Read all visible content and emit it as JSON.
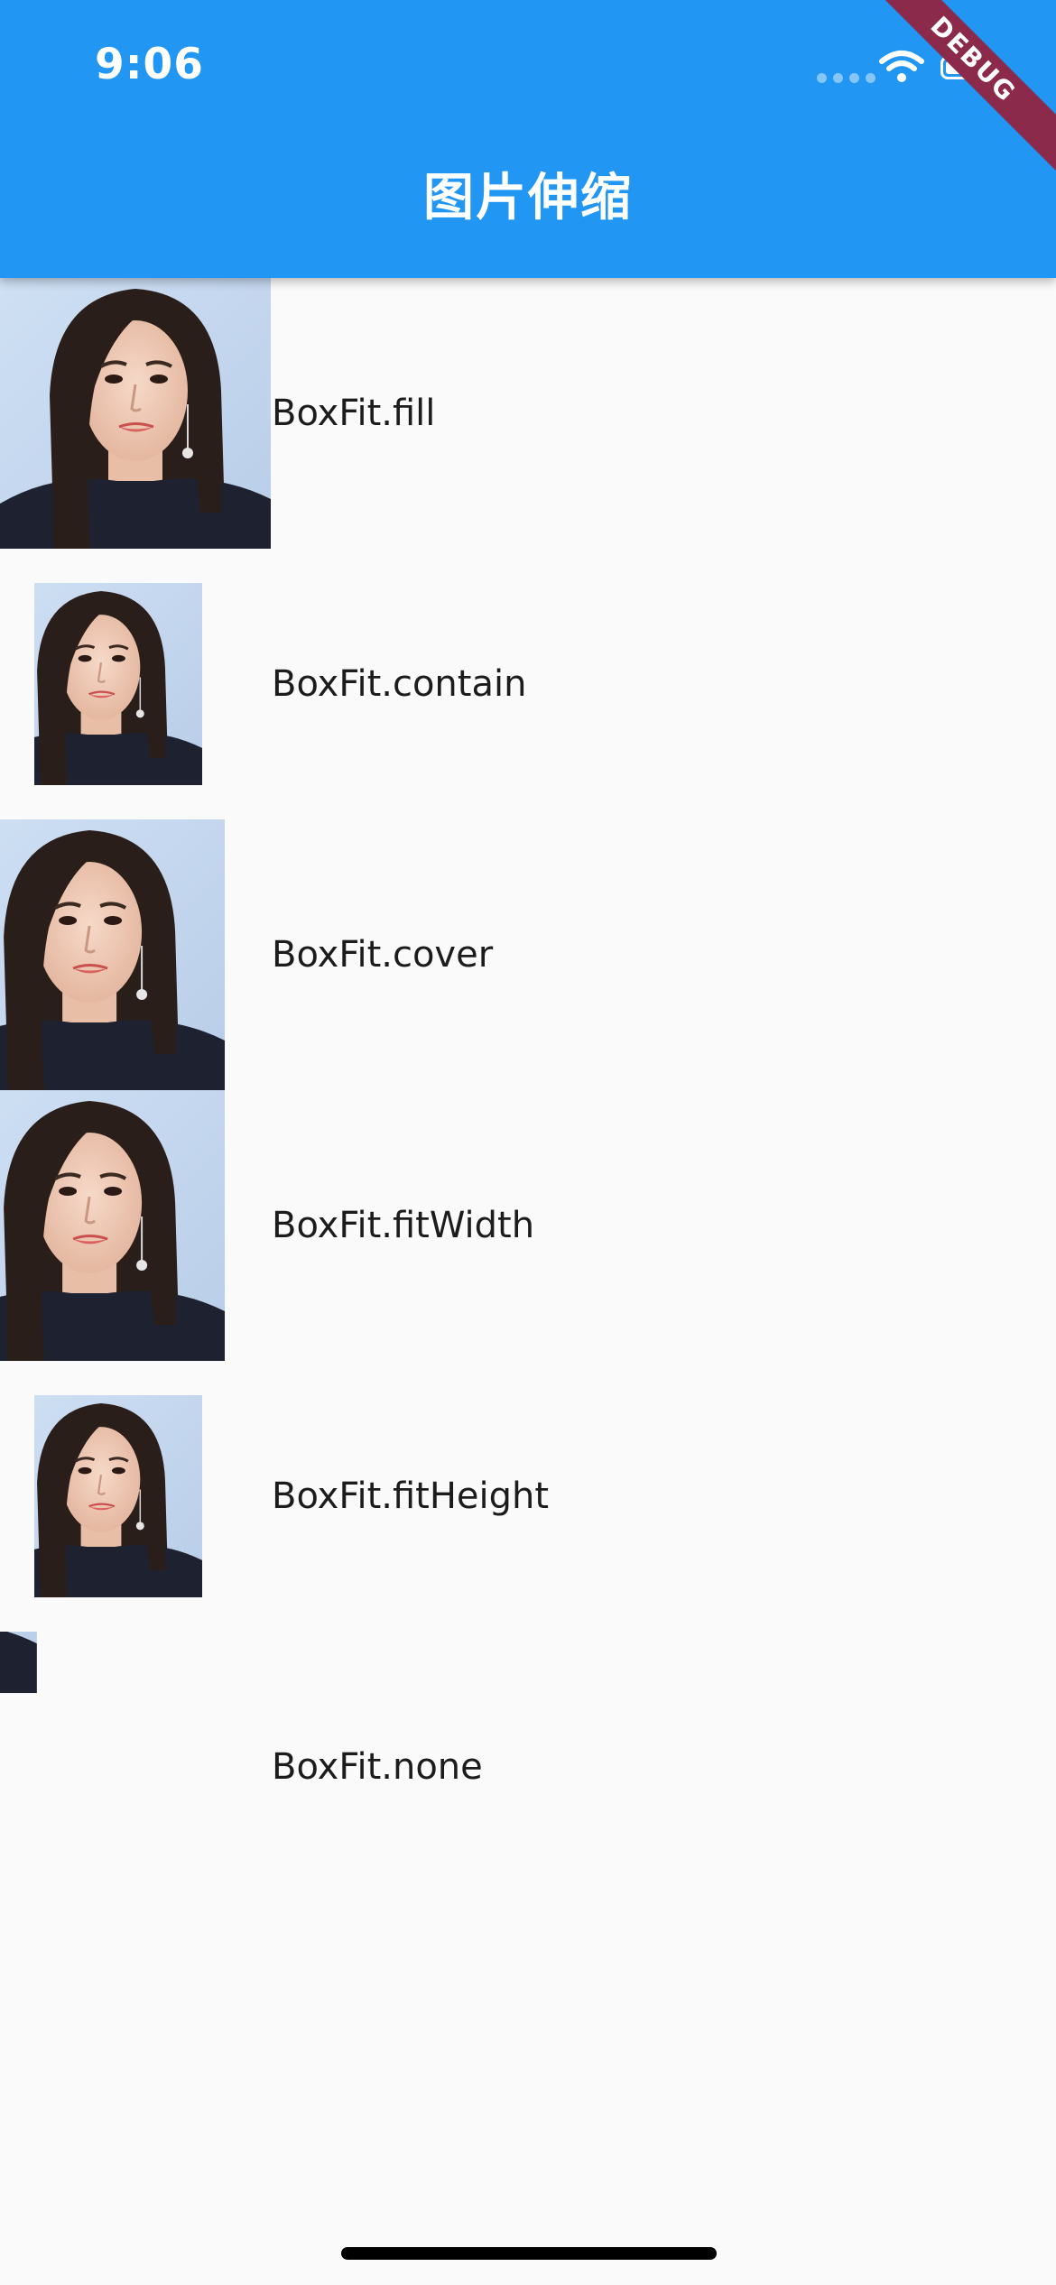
{
  "status_bar": {
    "time": "9:06"
  },
  "app_bar": {
    "title": "图片伸缩",
    "debug_label": "DEBUG",
    "background_color": "#2196f3"
  },
  "list": {
    "items": [
      {
        "label": "BoxFit.fill"
      },
      {
        "label": "BoxFit.contain"
      },
      {
        "label": "BoxFit.cover"
      },
      {
        "label": "BoxFit.fitWidth"
      },
      {
        "label": "BoxFit.fitHeight"
      },
      {
        "label": "BoxFit.none"
      }
    ]
  },
  "icons": [
    "signal-dots-icon",
    "wifi-icon",
    "battery-icon"
  ]
}
